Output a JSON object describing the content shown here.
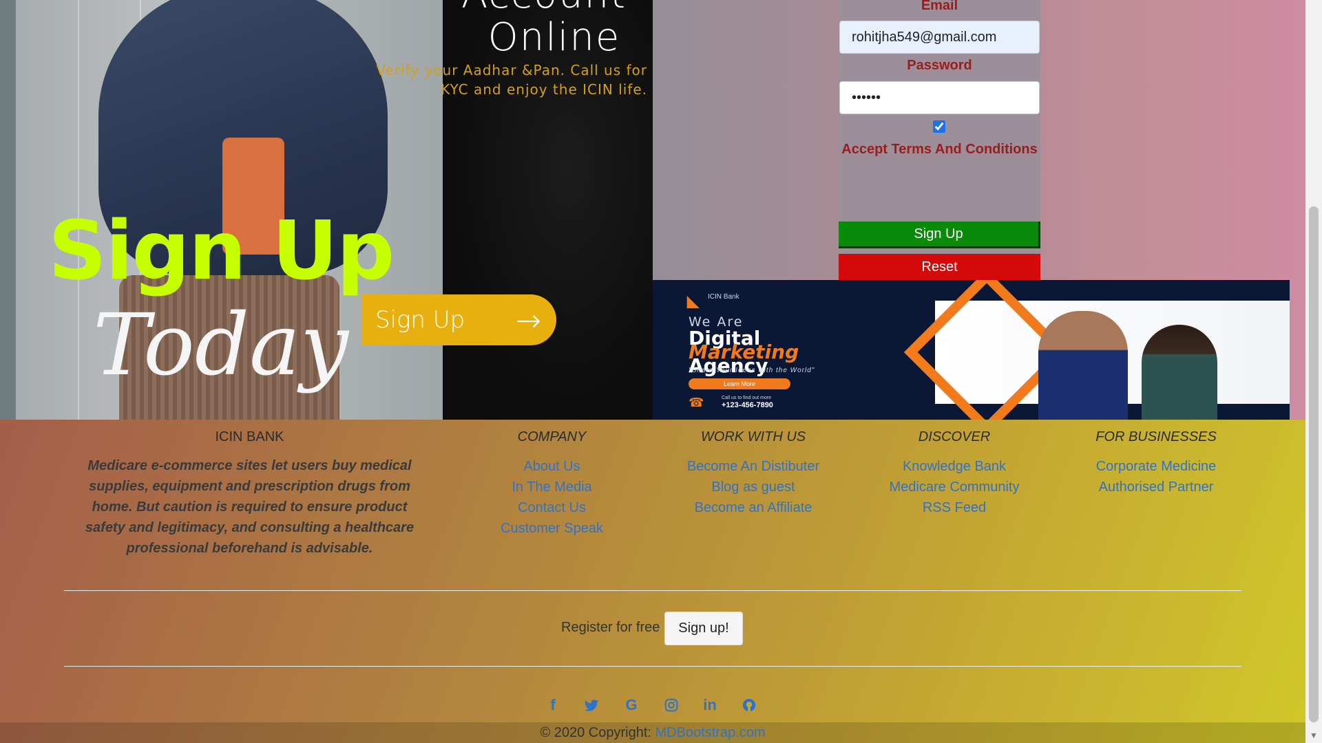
{
  "promo": {
    "headline_line1": "Account",
    "headline_line2": "Online",
    "kyc_text": "Verify your Aadhar &Pan. Call us for KYC and enjoy the ICIN life.",
    "big_signup": "Sign Up",
    "today": "Today",
    "signup_button": "Sign Up",
    "arrow": "→"
  },
  "form": {
    "email_label": "Email",
    "email_value": "rohitjha549@gmail.com",
    "password_label": "Password",
    "password_value": "••••••",
    "terms_label": "Accept Terms And Conditions",
    "terms_checked": true,
    "signup_button": "Sign Up",
    "reset_button": "Reset"
  },
  "ad": {
    "logo_text": "ICIN Bank",
    "we_are": "We Are",
    "digital": "Digital",
    "marketing": "Marketing",
    "agency": "Agency",
    "tagline": "\"Share Your Ideas with the World\"",
    "learn_more": "Learn More",
    "phone_label": "Call us to find out more",
    "phone": "+123-456-7890"
  },
  "footer": {
    "brand_title": "ICIN BANK",
    "about": "Medicare e-commerce sites let users buy medical supplies, equipment and prescription drugs from home. But caution is required to ensure product safety and legitimacy, and consulting a healthcare professional beforehand is advisable.",
    "columns": [
      {
        "title": "COMPANY",
        "links": [
          "About Us",
          "In The Media",
          "Contact Us",
          "Customer Speak"
        ]
      },
      {
        "title": "WORK WITH US",
        "links": [
          "Become An Distibuter",
          "Blog as guest",
          "Become an Affiliate"
        ]
      },
      {
        "title": "DISCOVER",
        "links": [
          "Knowledge Bank",
          "Medicare Community",
          "RSS Feed"
        ]
      },
      {
        "title": "FOR BUSINESSES",
        "links": [
          "Corporate Medicine",
          "Authorised Partner"
        ]
      }
    ],
    "register_label": "Register for free",
    "register_button": "Sign up!",
    "social_icons": [
      "facebook-icon",
      "twitter-icon",
      "google-icon",
      "instagram-icon",
      "linkedin-icon",
      "github-icon"
    ],
    "copyright_prefix": "© 2020 Copyright:",
    "copyright_link": "MDBootstrap.com"
  },
  "colors": {
    "form_label": "#9b1c1c",
    "signup_green": "#0a8a0a",
    "reset_red": "#d40a0a",
    "lime": "#c6ff00",
    "yellow": "#e8b00f",
    "link_blue": "#2f73c9"
  }
}
